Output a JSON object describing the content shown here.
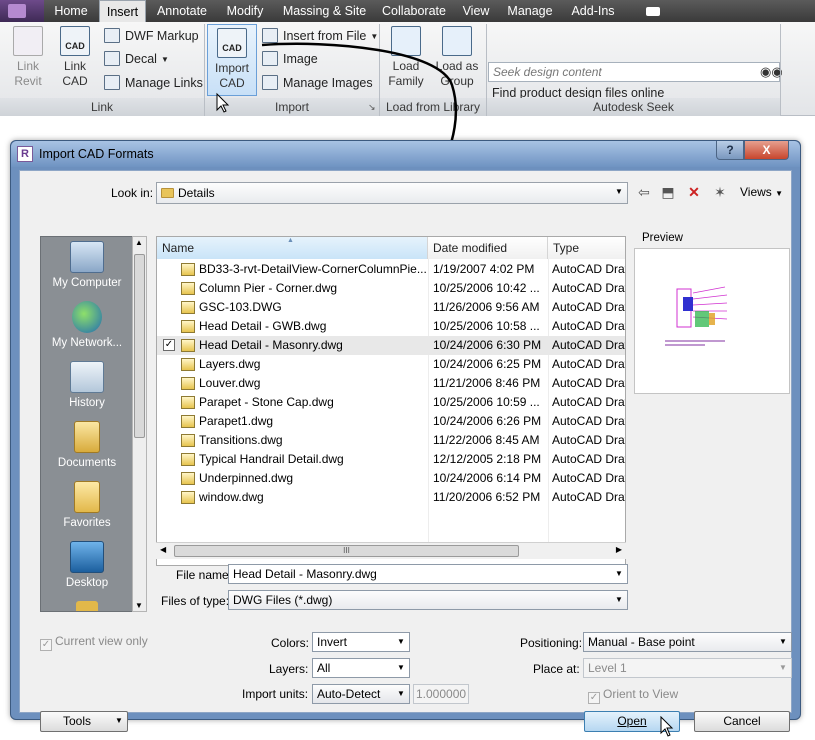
{
  "ribbon": {
    "tabs": [
      "Home",
      "Insert",
      "Annotate",
      "Modify",
      "Massing & Site",
      "Collaborate",
      "View",
      "Manage",
      "Add-Ins"
    ],
    "active_tab": "Insert",
    "link_panel": {
      "title": "Link",
      "link_revit": "Link\nRevit",
      "link_cad": "Link\nCAD",
      "dwf_markup": "DWF Markup",
      "decal": "Decal",
      "manage_links": "Manage Links"
    },
    "import_panel": {
      "title": "Import",
      "import_cad": "Import\nCAD",
      "insert_from_file": "Insert from File",
      "image": "Image",
      "manage_images": "Manage Images"
    },
    "library_panel": {
      "title": "Load from Library",
      "load_family": "Load\nFamily",
      "load_as_group": "Load as\nGroup"
    },
    "seek_panel": {
      "title": "Autodesk Seek",
      "placeholder": "Seek design content",
      "link": "Find product design files online"
    }
  },
  "dialog": {
    "title": "Import CAD Formats",
    "help_label": "?",
    "close_label": "X",
    "look_in_label": "Look in:",
    "look_in_value": "Details",
    "views_label": "Views",
    "preview_label": "Preview",
    "places": [
      "My Computer",
      "My Network...",
      "History",
      "Documents",
      "Favorites",
      "Desktop"
    ],
    "columns": [
      "Name",
      "Date modified",
      "Type"
    ],
    "files": [
      {
        "name": "BD33-3-rvt-DetailView-CornerColumnPie...",
        "date": "1/19/2007 4:02 PM",
        "type": "AutoCAD Draw"
      },
      {
        "name": "Column Pier - Corner.dwg",
        "date": "10/25/2006 10:42 ...",
        "type": "AutoCAD Draw"
      },
      {
        "name": "GSC-103.DWG",
        "date": "11/26/2006 9:56 AM",
        "type": "AutoCAD Draw"
      },
      {
        "name": "Head Detail - GWB.dwg",
        "date": "10/25/2006 10:58 ...",
        "type": "AutoCAD Draw"
      },
      {
        "name": "Head Detail - Masonry.dwg",
        "date": "10/24/2006 6:30 PM",
        "type": "AutoCAD Draw"
      },
      {
        "name": "Layers.dwg",
        "date": "10/24/2006 6:25 PM",
        "type": "AutoCAD Draw"
      },
      {
        "name": "Louver.dwg",
        "date": "11/21/2006 8:46 PM",
        "type": "AutoCAD Draw"
      },
      {
        "name": "Parapet - Stone Cap.dwg",
        "date": "10/25/2006 10:59 ...",
        "type": "AutoCAD Draw"
      },
      {
        "name": "Parapet1.dwg",
        "date": "10/24/2006 6:26 PM",
        "type": "AutoCAD Draw"
      },
      {
        "name": "Transitions.dwg",
        "date": "11/22/2006 8:45 AM",
        "type": "AutoCAD Draw"
      },
      {
        "name": "Typical Handrail Detail.dwg",
        "date": "12/12/2005 2:18 PM",
        "type": "AutoCAD Draw"
      },
      {
        "name": "Underpinned.dwg",
        "date": "10/24/2006 6:14 PM",
        "type": "AutoCAD Draw"
      },
      {
        "name": "window.dwg",
        "date": "11/20/2006 6:52 PM",
        "type": "AutoCAD Draw"
      }
    ],
    "selected_file": "Head Detail - Masonry.dwg",
    "hscroll_grip": "III",
    "file_name_label": "File name:",
    "file_name_value": "Head Detail - Masonry.dwg",
    "files_of_type_label": "Files of type:",
    "files_of_type_value": "DWG Files  (*.dwg)",
    "current_view_only": "Current view only",
    "colors_label": "Colors:",
    "colors_value": "Invert",
    "layers_label": "Layers:",
    "layers_value": "All",
    "import_units_label": "Import units:",
    "import_units_value": "Auto-Detect",
    "units_factor": "1.000000",
    "positioning_label": "Positioning:",
    "positioning_value": "Manual - Base point",
    "place_at_label": "Place at:",
    "place_at_value": "Level 1",
    "orient_to_view": "Orient to View",
    "tools_label": "Tools",
    "open_label": "Open",
    "cancel_label": "Cancel"
  },
  "colors": {
    "accent_blue": "#6d90be",
    "selection_gray": "#e8e8e8",
    "places_gray": "#8a8f94"
  }
}
